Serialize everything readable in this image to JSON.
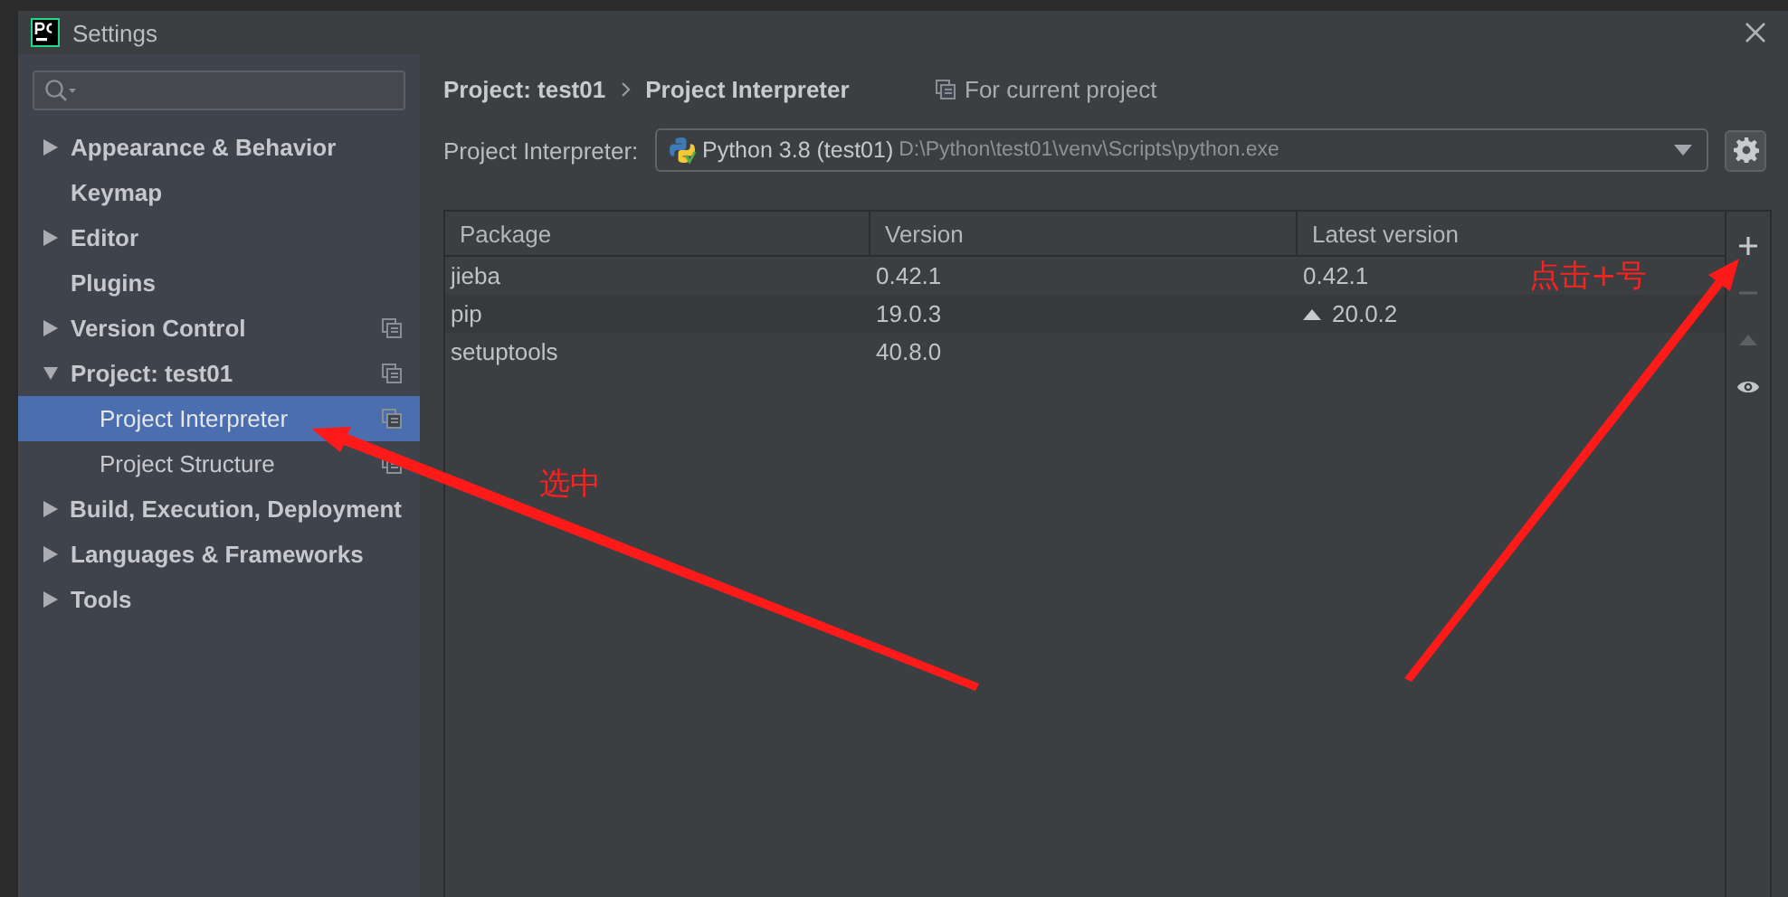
{
  "window": {
    "title": "Settings"
  },
  "sidebar": {
    "items": [
      {
        "label": "Appearance & Behavior",
        "kind": "folder",
        "expanded": false,
        "selected": false,
        "project_scoped": false
      },
      {
        "label": "Keymap",
        "kind": "leaf",
        "selected": false,
        "project_scoped": false
      },
      {
        "label": "Editor",
        "kind": "folder",
        "expanded": false,
        "selected": false,
        "project_scoped": false
      },
      {
        "label": "Plugins",
        "kind": "leaf",
        "selected": false,
        "project_scoped": false
      },
      {
        "label": "Version Control",
        "kind": "folder",
        "expanded": false,
        "selected": false,
        "project_scoped": true
      },
      {
        "label": "Project: test01",
        "kind": "folder",
        "expanded": true,
        "selected": false,
        "project_scoped": true,
        "children": [
          {
            "label": "Project Interpreter",
            "kind": "leaf",
            "selected": true,
            "project_scoped": true
          },
          {
            "label": "Project Structure",
            "kind": "leaf",
            "selected": false,
            "project_scoped": true
          }
        ]
      },
      {
        "label": "Build, Execution, Deployment",
        "kind": "folder",
        "expanded": false,
        "selected": false,
        "project_scoped": false
      },
      {
        "label": "Languages & Frameworks",
        "kind": "folder",
        "expanded": false,
        "selected": false,
        "project_scoped": false
      },
      {
        "label": "Tools",
        "kind": "folder",
        "expanded": false,
        "selected": false,
        "project_scoped": false
      }
    ]
  },
  "breadcrumb": [
    "Project: test01",
    "Project Interpreter"
  ],
  "scope_note": "For current project",
  "interpreter": {
    "label": "Project Interpreter:",
    "name": "Python 3.8 (test01)",
    "path": "D:\\Python\\test01\\venv\\Scripts\\python.exe"
  },
  "table": {
    "columns": [
      "Package",
      "Version",
      "Latest version"
    ],
    "rows": [
      {
        "cells": [
          "jieba",
          "0.42.1",
          "0.42.1"
        ],
        "upgrade": false
      },
      {
        "cells": [
          "pip",
          "19.0.3",
          "20.0.2"
        ],
        "upgrade": true
      },
      {
        "cells": [
          "setuptools",
          "40.8.0",
          ""
        ],
        "upgrade": false
      }
    ]
  },
  "toolbar": [
    {
      "kind": "add",
      "disabled": false
    },
    {
      "kind": "remove",
      "disabled": true
    },
    {
      "kind": "upgrade",
      "disabled": true
    },
    {
      "kind": "show",
      "disabled": false
    }
  ],
  "annotations": [
    {
      "text": "选中"
    },
    {
      "text": "点击+号"
    }
  ]
}
